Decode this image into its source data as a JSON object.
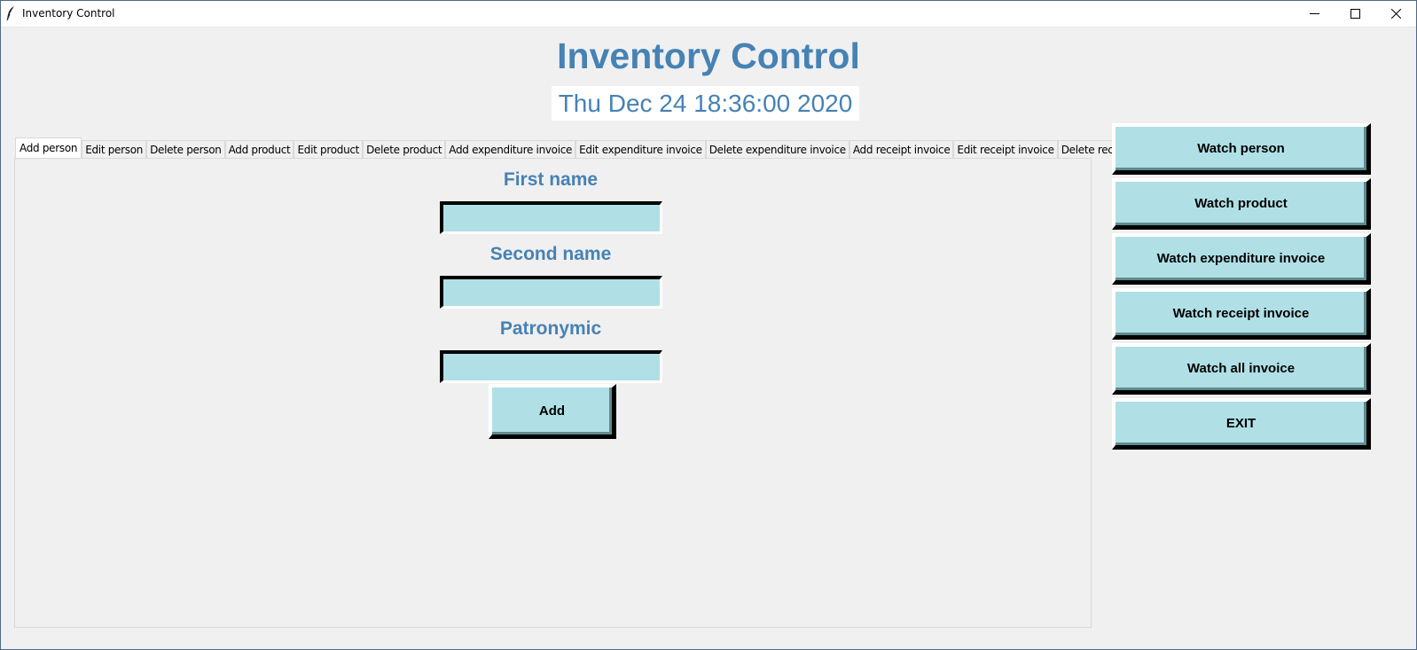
{
  "window": {
    "title": "Inventory Control",
    "controls": [
      "minimize-icon",
      "maximize-icon",
      "close-icon"
    ]
  },
  "header": {
    "title": "Inventory Control",
    "clock": "Thu Dec 24 18:36:00 2020"
  },
  "tabs": [
    {
      "label": "Add person",
      "active": true
    },
    {
      "label": "Edit person"
    },
    {
      "label": "Delete person"
    },
    {
      "label": "Add product"
    },
    {
      "label": "Edit product"
    },
    {
      "label": "Delete product"
    },
    {
      "label": "Add expenditure invoice"
    },
    {
      "label": "Edit expenditure invoice"
    },
    {
      "label": "Delete expenditure invoice"
    },
    {
      "label": "Add receipt invoice"
    },
    {
      "label": "Edit receipt invoice"
    },
    {
      "label": "Delete receipt invoice"
    }
  ],
  "form": {
    "first_name_label": "First name",
    "first_name_value": "",
    "second_name_label": "Second name",
    "second_name_value": "",
    "patronymic_label": "Patronymic",
    "patronymic_value": "",
    "add_label": "Add"
  },
  "sidebar": {
    "buttons": [
      {
        "label": "Watch person"
      },
      {
        "label": "Watch product"
      },
      {
        "label": "Watch expenditure invoice"
      },
      {
        "label": "Watch receipt invoice"
      },
      {
        "label": "Watch all invoice"
      },
      {
        "label": "EXIT"
      }
    ]
  },
  "colors": {
    "accent": "#4682b4",
    "button_bg": "#b0e0e6",
    "window_bg": "#f0f0f0"
  }
}
